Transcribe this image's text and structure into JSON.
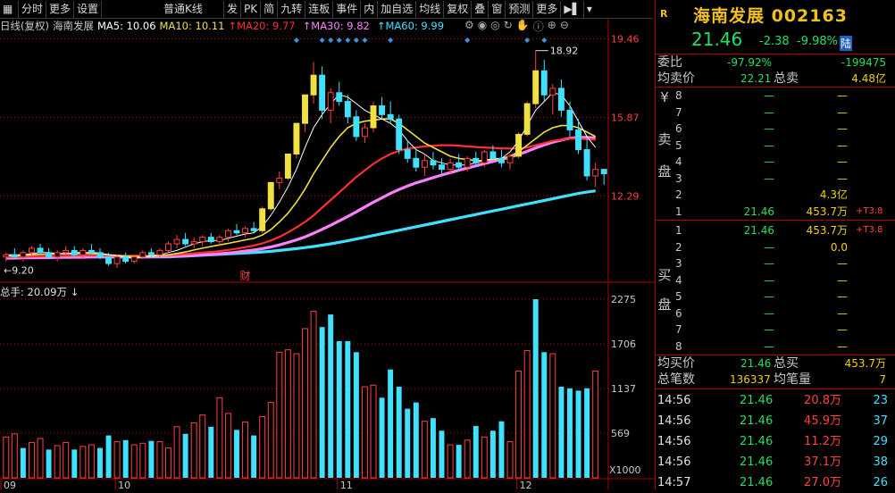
{
  "toolbar": {
    "items": [
      "分时",
      "更多",
      "设置",
      "普通K线",
      "发",
      "PK",
      "简",
      "九转",
      "连板",
      "事件",
      "内",
      "加自选",
      "均线",
      "复权",
      "叠",
      "窗",
      "预测",
      "更多"
    ]
  },
  "legend": {
    "period": "日线(复权)",
    "name": "海南发展",
    "ma5": "MA5: 10.06",
    "ma10": "MA10: 10.11",
    "ma20": "MA20: 9.77",
    "ma30": "MA30: 9.82",
    "ma60": "MA60: 9.99"
  },
  "colors": {
    "up": "#ff4040",
    "down": "#40e0ff",
    "ma5": "#ffffff",
    "ma10": "#f0e040",
    "ma20": "#ff3030",
    "ma30": "#ff80ff",
    "ma60": "#40e0ff",
    "grid": "#b00000"
  },
  "price_axis": {
    "labels": [
      "19.46",
      "15.87",
      "12.29"
    ]
  },
  "price_high_label": "18.92",
  "price_low_label": "9.20",
  "volume_axis": {
    "labels": [
      "2275",
      "1706",
      "1137",
      "569",
      "X1000"
    ]
  },
  "volume_title": "总手: 20.09万",
  "event_marker": "财",
  "x_axis": [
    "09",
    "10",
    "11",
    "12"
  ],
  "chart_data": {
    "type": "candlestick",
    "candles": [
      {
        "o": 9.5,
        "h": 9.7,
        "l": 9.3,
        "c": 9.6
      },
      {
        "o": 9.6,
        "h": 9.9,
        "l": 9.4,
        "c": 9.5
      },
      {
        "o": 9.5,
        "h": 9.8,
        "l": 9.3,
        "c": 9.7
      },
      {
        "o": 9.7,
        "h": 10.0,
        "l": 9.5,
        "c": 9.9
      },
      {
        "o": 9.9,
        "h": 10.1,
        "l": 9.6,
        "c": 9.7
      },
      {
        "o": 9.7,
        "h": 9.9,
        "l": 9.4,
        "c": 9.5
      },
      {
        "o": 9.5,
        "h": 9.8,
        "l": 9.3,
        "c": 9.7
      },
      {
        "o": 9.7,
        "h": 10.0,
        "l": 9.5,
        "c": 9.8
      },
      {
        "o": 9.8,
        "h": 10.0,
        "l": 9.5,
        "c": 9.6
      },
      {
        "o": 9.6,
        "h": 9.9,
        "l": 9.4,
        "c": 9.8
      },
      {
        "o": 9.8,
        "h": 10.1,
        "l": 9.6,
        "c": 9.7
      },
      {
        "o": 9.7,
        "h": 9.9,
        "l": 9.4,
        "c": 9.5
      },
      {
        "o": 9.5,
        "h": 9.7,
        "l": 9.1,
        "c": 9.2
      },
      {
        "o": 9.2,
        "h": 9.6,
        "l": 9.0,
        "c": 9.5
      },
      {
        "o": 9.5,
        "h": 9.7,
        "l": 9.2,
        "c": 9.3
      },
      {
        "o": 9.3,
        "h": 9.6,
        "l": 9.2,
        "c": 9.5
      },
      {
        "o": 9.5,
        "h": 9.8,
        "l": 9.4,
        "c": 9.7
      },
      {
        "o": 9.7,
        "h": 9.9,
        "l": 9.5,
        "c": 9.6
      },
      {
        "o": 9.6,
        "h": 9.9,
        "l": 9.5,
        "c": 9.8
      },
      {
        "o": 9.8,
        "h": 10.2,
        "l": 9.7,
        "c": 10.1
      },
      {
        "o": 10.1,
        "h": 10.5,
        "l": 9.9,
        "c": 10.3
      },
      {
        "o": 10.3,
        "h": 10.6,
        "l": 10.0,
        "c": 10.1
      },
      {
        "o": 10.1,
        "h": 10.4,
        "l": 9.9,
        "c": 10.2
      },
      {
        "o": 10.2,
        "h": 10.5,
        "l": 10.0,
        "c": 10.4
      },
      {
        "o": 10.4,
        "h": 10.6,
        "l": 10.1,
        "c": 10.2
      },
      {
        "o": 10.2,
        "h": 10.5,
        "l": 10.0,
        "c": 10.4
      },
      {
        "o": 10.4,
        "h": 10.8,
        "l": 10.2,
        "c": 10.7
      },
      {
        "o": 10.7,
        "h": 11.0,
        "l": 10.5,
        "c": 10.6
      },
      {
        "o": 10.6,
        "h": 10.9,
        "l": 10.4,
        "c": 10.8
      },
      {
        "o": 10.8,
        "h": 11.1,
        "l": 10.6,
        "c": 10.7
      },
      {
        "o": 10.7,
        "h": 11.8,
        "l": 10.6,
        "c": 11.7
      },
      {
        "o": 11.7,
        "h": 12.9,
        "l": 11.6,
        "c": 12.9
      },
      {
        "o": 12.9,
        "h": 13.4,
        "l": 12.6,
        "c": 13.1
      },
      {
        "o": 13.1,
        "h": 14.2,
        "l": 13.0,
        "c": 14.2
      },
      {
        "o": 14.2,
        "h": 15.6,
        "l": 14.0,
        "c": 15.6
      },
      {
        "o": 15.6,
        "h": 16.8,
        "l": 15.2,
        "c": 16.9
      },
      {
        "o": 16.9,
        "h": 18.4,
        "l": 16.5,
        "c": 17.8
      },
      {
        "o": 17.8,
        "h": 18.2,
        "l": 15.8,
        "c": 16.2
      },
      {
        "o": 16.2,
        "h": 17.2,
        "l": 15.6,
        "c": 17.0
      },
      {
        "o": 17.0,
        "h": 17.5,
        "l": 16.4,
        "c": 16.6
      },
      {
        "o": 16.6,
        "h": 16.9,
        "l": 15.6,
        "c": 15.9
      },
      {
        "o": 15.9,
        "h": 16.2,
        "l": 14.8,
        "c": 15.0
      },
      {
        "o": 15.0,
        "h": 15.6,
        "l": 14.7,
        "c": 15.4
      },
      {
        "o": 15.4,
        "h": 16.6,
        "l": 15.2,
        "c": 16.4
      },
      {
        "o": 16.4,
        "h": 16.8,
        "l": 15.8,
        "c": 16.0
      },
      {
        "o": 16.0,
        "h": 16.6,
        "l": 15.6,
        "c": 15.8
      },
      {
        "o": 15.8,
        "h": 16.0,
        "l": 14.2,
        "c": 14.4
      },
      {
        "o": 14.4,
        "h": 14.8,
        "l": 13.8,
        "c": 14.0
      },
      {
        "o": 14.0,
        "h": 14.4,
        "l": 13.4,
        "c": 13.6
      },
      {
        "o": 13.6,
        "h": 14.2,
        "l": 13.2,
        "c": 13.9
      },
      {
        "o": 13.9,
        "h": 14.3,
        "l": 13.5,
        "c": 13.7
      },
      {
        "o": 13.7,
        "h": 14.0,
        "l": 13.3,
        "c": 13.5
      },
      {
        "o": 13.5,
        "h": 14.0,
        "l": 13.3,
        "c": 13.8
      },
      {
        "o": 13.8,
        "h": 14.2,
        "l": 13.4,
        "c": 13.6
      },
      {
        "o": 13.6,
        "h": 14.1,
        "l": 13.4,
        "c": 14.0
      },
      {
        "o": 14.0,
        "h": 14.3,
        "l": 13.6,
        "c": 13.8
      },
      {
        "o": 13.8,
        "h": 14.4,
        "l": 13.6,
        "c": 14.3
      },
      {
        "o": 14.3,
        "h": 14.6,
        "l": 13.9,
        "c": 14.0
      },
      {
        "o": 14.0,
        "h": 14.4,
        "l": 13.6,
        "c": 13.8
      },
      {
        "o": 13.8,
        "h": 14.2,
        "l": 13.5,
        "c": 14.1
      },
      {
        "o": 14.1,
        "h": 15.2,
        "l": 14.0,
        "c": 15.1
      },
      {
        "o": 15.1,
        "h": 16.6,
        "l": 15.0,
        "c": 16.5
      },
      {
        "o": 16.5,
        "h": 18.92,
        "l": 16.3,
        "c": 18.0
      },
      {
        "o": 18.0,
        "h": 18.5,
        "l": 16.6,
        "c": 16.9
      },
      {
        "o": 16.9,
        "h": 17.4,
        "l": 16.0,
        "c": 17.2
      },
      {
        "o": 17.2,
        "h": 17.6,
        "l": 15.9,
        "c": 16.2
      },
      {
        "o": 16.2,
        "h": 16.6,
        "l": 15.0,
        "c": 15.3
      },
      {
        "o": 15.3,
        "h": 15.8,
        "l": 14.2,
        "c": 14.4
      },
      {
        "o": 14.4,
        "h": 14.9,
        "l": 13.0,
        "c": 13.2
      },
      {
        "o": 13.2,
        "h": 13.8,
        "l": 12.7,
        "c": 13.5
      },
      {
        "o": 13.5,
        "h": 13.5,
        "l": 12.8,
        "c": 13.3
      }
    ],
    "ma5": [
      9.6,
      9.6,
      9.6,
      9.65,
      9.7,
      9.7,
      9.65,
      9.65,
      9.7,
      9.7,
      9.7,
      9.68,
      9.6,
      9.55,
      9.5,
      9.45,
      9.5,
      9.55,
      9.6,
      9.7,
      9.8,
      9.95,
      10.1,
      10.2,
      10.25,
      10.25,
      10.35,
      10.45,
      10.55,
      10.6,
      10.9,
      11.4,
      12.0,
      12.7,
      13.5,
      14.5,
      15.4,
      16.0,
      16.5,
      16.9,
      16.8,
      16.5,
      16.2,
      16.0,
      15.8,
      15.6,
      15.3,
      14.8,
      14.4,
      14.2,
      13.9,
      13.8,
      13.7,
      13.7,
      13.7,
      13.8,
      13.9,
      14.0,
      14.0,
      14.3,
      14.8,
      15.5,
      16.2,
      16.6,
      17.0,
      16.9,
      16.4,
      15.7,
      15.0,
      14.5
    ],
    "ma10": [
      9.55,
      9.56,
      9.58,
      9.6,
      9.62,
      9.63,
      9.64,
      9.65,
      9.66,
      9.67,
      9.66,
      9.64,
      9.6,
      9.57,
      9.54,
      9.52,
      9.52,
      9.54,
      9.56,
      9.6,
      9.66,
      9.73,
      9.82,
      9.9,
      9.98,
      10.05,
      10.12,
      10.2,
      10.28,
      10.35,
      10.5,
      10.75,
      11.1,
      11.5,
      12.0,
      12.6,
      13.3,
      13.9,
      14.5,
      15.0,
      15.4,
      15.6,
      15.7,
      15.75,
      15.8,
      15.8,
      15.6,
      15.3,
      15.0,
      14.7,
      14.5,
      14.3,
      14.1,
      14.0,
      13.95,
      13.9,
      13.9,
      13.95,
      14.0,
      14.1,
      14.3,
      14.6,
      14.9,
      15.2,
      15.4,
      15.5,
      15.5,
      15.4,
      15.2,
      15.0
    ],
    "ma20": [
      9.5,
      9.5,
      9.51,
      9.52,
      9.53,
      9.54,
      9.55,
      9.56,
      9.57,
      9.58,
      9.58,
      9.58,
      9.57,
      9.56,
      9.55,
      9.55,
      9.55,
      9.56,
      9.57,
      9.59,
      9.61,
      9.64,
      9.67,
      9.7,
      9.73,
      9.77,
      9.82,
      9.88,
      9.95,
      10.02,
      10.12,
      10.25,
      10.42,
      10.62,
      10.85,
      11.1,
      11.4,
      11.75,
      12.1,
      12.45,
      12.8,
      13.15,
      13.45,
      13.75,
      14.0,
      14.2,
      14.35,
      14.45,
      14.5,
      14.55,
      14.58,
      14.6,
      14.6,
      14.58,
      14.55,
      14.52,
      14.5,
      14.48,
      14.46,
      14.45,
      14.45,
      14.5,
      14.6,
      14.7,
      14.8,
      14.85,
      14.9,
      14.9,
      14.88,
      14.85
    ],
    "ma30": [
      9.45,
      9.45,
      9.46,
      9.46,
      9.47,
      9.47,
      9.48,
      9.48,
      9.49,
      9.49,
      9.5,
      9.5,
      9.5,
      9.5,
      9.5,
      9.5,
      9.5,
      9.51,
      9.52,
      9.53,
      9.54,
      9.56,
      9.58,
      9.6,
      9.62,
      9.65,
      9.68,
      9.72,
      9.77,
      9.82,
      9.88,
      9.96,
      10.05,
      10.16,
      10.28,
      10.42,
      10.58,
      10.76,
      10.95,
      11.15,
      11.35,
      11.56,
      11.78,
      12.0,
      12.2,
      12.4,
      12.58,
      12.74,
      12.88,
      13.0,
      13.12,
      13.24,
      13.35,
      13.46,
      13.56,
      13.66,
      13.76,
      13.86,
      13.96,
      14.06,
      14.18,
      14.32,
      14.48,
      14.62,
      14.74,
      14.84,
      14.92,
      14.96,
      14.96,
      14.94
    ],
    "ma60": [
      9.5,
      9.5,
      9.5,
      9.5,
      9.5,
      9.5,
      9.5,
      9.5,
      9.5,
      9.5,
      9.5,
      9.5,
      9.5,
      9.5,
      9.5,
      9.5,
      9.5,
      9.5,
      9.5,
      9.5,
      9.52,
      9.54,
      9.56,
      9.58,
      9.6,
      9.62,
      9.64,
      9.66,
      9.68,
      9.7,
      9.73,
      9.76,
      9.8,
      9.84,
      9.88,
      9.93,
      9.98,
      10.04,
      10.1,
      10.17,
      10.24,
      10.32,
      10.4,
      10.48,
      10.56,
      10.64,
      10.72,
      10.8,
      10.88,
      10.96,
      11.04,
      11.12,
      11.2,
      11.28,
      11.36,
      11.44,
      11.52,
      11.6,
      11.68,
      11.76,
      11.84,
      11.92,
      12.0,
      12.08,
      12.16,
      12.24,
      12.32,
      12.4,
      12.46,
      12.52
    ],
    "volume": [
      520,
      560,
      380,
      450,
      500,
      360,
      410,
      450,
      360,
      400,
      420,
      380,
      540,
      460,
      480,
      420,
      440,
      470,
      460,
      380,
      650,
      560,
      700,
      800,
      650,
      1020,
      820,
      610,
      710,
      540,
      780,
      960,
      1600,
      1630,
      1580,
      1900,
      2120,
      1920,
      2080,
      1740,
      1740,
      1600,
      1160,
      1180,
      1020,
      1380,
      1160,
      880,
      960,
      720,
      760,
      600,
      420,
      420,
      480,
      660,
      520,
      600,
      720,
      460,
      1360,
      1620,
      2275,
      1600,
      1580,
      1160,
      1140,
      1110,
      1140,
      1360
    ],
    "volume_up": [
      true,
      true,
      false,
      true,
      true,
      false,
      true,
      true,
      false,
      true,
      true,
      false,
      false,
      true,
      false,
      true,
      true,
      false,
      true,
      true,
      true,
      false,
      true,
      true,
      false,
      true,
      true,
      false,
      true,
      false,
      true,
      true,
      true,
      true,
      true,
      true,
      true,
      false,
      false,
      false,
      false,
      false,
      true,
      true,
      false,
      false,
      false,
      false,
      false,
      true,
      false,
      false,
      true,
      false,
      true,
      false,
      true,
      false,
      false,
      true,
      true,
      true,
      false,
      false,
      true,
      false,
      false,
      false,
      false,
      true
    ],
    "ylim": [
      9.0,
      19.6
    ],
    "vol_lim": [
      0,
      2400
    ]
  },
  "quote": {
    "badge": "R",
    "title": "海南发展 002163",
    "price": "21.46",
    "change": "-2.38",
    "pct": "-9.98%",
    "tag": "陆"
  },
  "stats": {
    "weibi_label": "委比",
    "weibi_pct": "-97.92%",
    "weibi_val": "-199475",
    "junmai_label": "均卖价",
    "junmai_val": "22.21",
    "zongmai_label": "总卖",
    "zongmai_val": "4.48亿"
  },
  "sell": {
    "side_label": "卖盘",
    "rows": [
      {
        "n": "8",
        "p": "—",
        "v": "—",
        "x": ""
      },
      {
        "n": "7",
        "p": "—",
        "v": "—",
        "x": ""
      },
      {
        "n": "6",
        "p": "—",
        "v": "—",
        "x": ""
      },
      {
        "n": "5",
        "p": "—",
        "v": "—",
        "x": ""
      },
      {
        "n": "4",
        "p": "—",
        "v": "—",
        "x": ""
      },
      {
        "n": "3",
        "p": "—",
        "v": "—",
        "x": ""
      },
      {
        "n": "2",
        "p": "",
        "v": "4.3亿",
        "x": ""
      },
      {
        "n": "1",
        "p": "21.46",
        "v": "453.7万",
        "x": "+T3.8"
      }
    ]
  },
  "buy": {
    "side_label": "买盘",
    "rows": [
      {
        "n": "1",
        "p": "21.46",
        "v": "453.7万",
        "x": "+T3.8"
      },
      {
        "n": "2",
        "p": "—",
        "v": "0.0",
        "x": ""
      },
      {
        "n": "3",
        "p": "—",
        "v": "—",
        "x": ""
      },
      {
        "n": "4",
        "p": "—",
        "v": "—",
        "x": ""
      },
      {
        "n": "5",
        "p": "—",
        "v": "—",
        "x": ""
      },
      {
        "n": "6",
        "p": "—",
        "v": "—",
        "x": ""
      },
      {
        "n": "7",
        "p": "—",
        "v": "—",
        "x": ""
      },
      {
        "n": "8",
        "p": "—",
        "v": "—",
        "x": ""
      }
    ]
  },
  "stats2": {
    "junmai_label": "均买价",
    "junmai_val": "21.46",
    "zongmai_label": "总买",
    "zongmai_val": "453.7万",
    "bishu_label": "总笔数",
    "bishu_val": "136337",
    "junbi_label": "均笔量",
    "junbi_val": "7"
  },
  "ticks": [
    {
      "t": "14:56",
      "p": "21.46",
      "v": "20.8万",
      "c": "23"
    },
    {
      "t": "14:56",
      "p": "21.46",
      "v": "45.9万",
      "c": "37"
    },
    {
      "t": "14:56",
      "p": "21.46",
      "v": "11.2万",
      "c": "29"
    },
    {
      "t": "14:56",
      "p": "21.46",
      "v": "37.1万",
      "c": "38"
    },
    {
      "t": "14:57",
      "p": "21.46",
      "v": "27.0万",
      "c": "26"
    }
  ]
}
